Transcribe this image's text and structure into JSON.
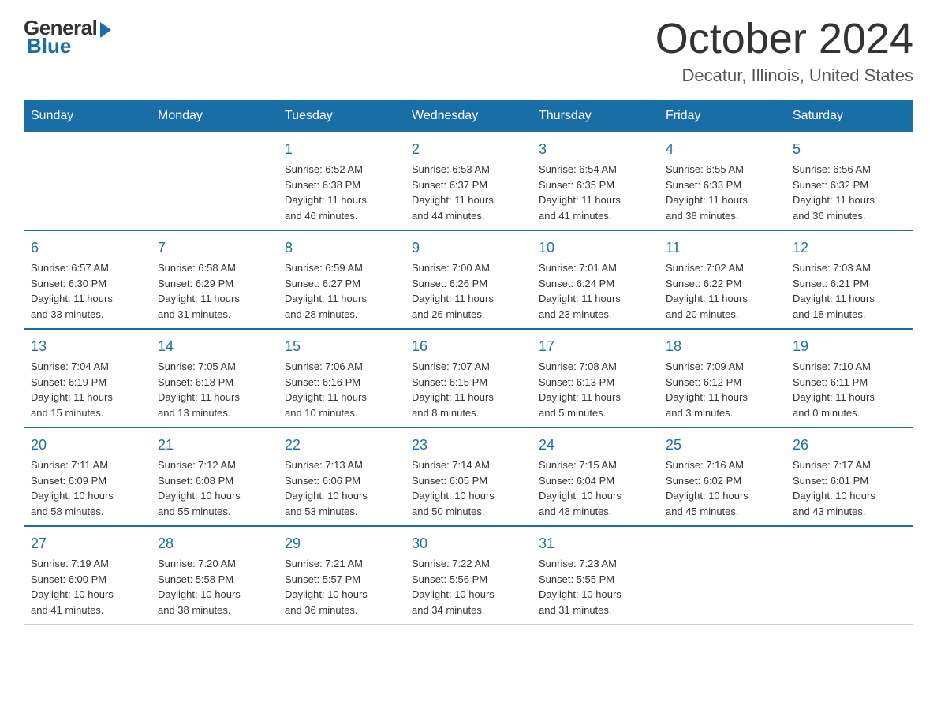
{
  "logo": {
    "general": "General",
    "blue": "Blue"
  },
  "title": "October 2024",
  "subtitle": "Decatur, Illinois, United States",
  "weekdays": [
    "Sunday",
    "Monday",
    "Tuesday",
    "Wednesday",
    "Thursday",
    "Friday",
    "Saturday"
  ],
  "weeks": [
    [
      {
        "day": "",
        "info": ""
      },
      {
        "day": "",
        "info": ""
      },
      {
        "day": "1",
        "info": "Sunrise: 6:52 AM\nSunset: 6:38 PM\nDaylight: 11 hours\nand 46 minutes."
      },
      {
        "day": "2",
        "info": "Sunrise: 6:53 AM\nSunset: 6:37 PM\nDaylight: 11 hours\nand 44 minutes."
      },
      {
        "day": "3",
        "info": "Sunrise: 6:54 AM\nSunset: 6:35 PM\nDaylight: 11 hours\nand 41 minutes."
      },
      {
        "day": "4",
        "info": "Sunrise: 6:55 AM\nSunset: 6:33 PM\nDaylight: 11 hours\nand 38 minutes."
      },
      {
        "day": "5",
        "info": "Sunrise: 6:56 AM\nSunset: 6:32 PM\nDaylight: 11 hours\nand 36 minutes."
      }
    ],
    [
      {
        "day": "6",
        "info": "Sunrise: 6:57 AM\nSunset: 6:30 PM\nDaylight: 11 hours\nand 33 minutes."
      },
      {
        "day": "7",
        "info": "Sunrise: 6:58 AM\nSunset: 6:29 PM\nDaylight: 11 hours\nand 31 minutes."
      },
      {
        "day": "8",
        "info": "Sunrise: 6:59 AM\nSunset: 6:27 PM\nDaylight: 11 hours\nand 28 minutes."
      },
      {
        "day": "9",
        "info": "Sunrise: 7:00 AM\nSunset: 6:26 PM\nDaylight: 11 hours\nand 26 minutes."
      },
      {
        "day": "10",
        "info": "Sunrise: 7:01 AM\nSunset: 6:24 PM\nDaylight: 11 hours\nand 23 minutes."
      },
      {
        "day": "11",
        "info": "Sunrise: 7:02 AM\nSunset: 6:22 PM\nDaylight: 11 hours\nand 20 minutes."
      },
      {
        "day": "12",
        "info": "Sunrise: 7:03 AM\nSunset: 6:21 PM\nDaylight: 11 hours\nand 18 minutes."
      }
    ],
    [
      {
        "day": "13",
        "info": "Sunrise: 7:04 AM\nSunset: 6:19 PM\nDaylight: 11 hours\nand 15 minutes."
      },
      {
        "day": "14",
        "info": "Sunrise: 7:05 AM\nSunset: 6:18 PM\nDaylight: 11 hours\nand 13 minutes."
      },
      {
        "day": "15",
        "info": "Sunrise: 7:06 AM\nSunset: 6:16 PM\nDaylight: 11 hours\nand 10 minutes."
      },
      {
        "day": "16",
        "info": "Sunrise: 7:07 AM\nSunset: 6:15 PM\nDaylight: 11 hours\nand 8 minutes."
      },
      {
        "day": "17",
        "info": "Sunrise: 7:08 AM\nSunset: 6:13 PM\nDaylight: 11 hours\nand 5 minutes."
      },
      {
        "day": "18",
        "info": "Sunrise: 7:09 AM\nSunset: 6:12 PM\nDaylight: 11 hours\nand 3 minutes."
      },
      {
        "day": "19",
        "info": "Sunrise: 7:10 AM\nSunset: 6:11 PM\nDaylight: 11 hours\nand 0 minutes."
      }
    ],
    [
      {
        "day": "20",
        "info": "Sunrise: 7:11 AM\nSunset: 6:09 PM\nDaylight: 10 hours\nand 58 minutes."
      },
      {
        "day": "21",
        "info": "Sunrise: 7:12 AM\nSunset: 6:08 PM\nDaylight: 10 hours\nand 55 minutes."
      },
      {
        "day": "22",
        "info": "Sunrise: 7:13 AM\nSunset: 6:06 PM\nDaylight: 10 hours\nand 53 minutes."
      },
      {
        "day": "23",
        "info": "Sunrise: 7:14 AM\nSunset: 6:05 PM\nDaylight: 10 hours\nand 50 minutes."
      },
      {
        "day": "24",
        "info": "Sunrise: 7:15 AM\nSunset: 6:04 PM\nDaylight: 10 hours\nand 48 minutes."
      },
      {
        "day": "25",
        "info": "Sunrise: 7:16 AM\nSunset: 6:02 PM\nDaylight: 10 hours\nand 45 minutes."
      },
      {
        "day": "26",
        "info": "Sunrise: 7:17 AM\nSunset: 6:01 PM\nDaylight: 10 hours\nand 43 minutes."
      }
    ],
    [
      {
        "day": "27",
        "info": "Sunrise: 7:19 AM\nSunset: 6:00 PM\nDaylight: 10 hours\nand 41 minutes."
      },
      {
        "day": "28",
        "info": "Sunrise: 7:20 AM\nSunset: 5:58 PM\nDaylight: 10 hours\nand 38 minutes."
      },
      {
        "day": "29",
        "info": "Sunrise: 7:21 AM\nSunset: 5:57 PM\nDaylight: 10 hours\nand 36 minutes."
      },
      {
        "day": "30",
        "info": "Sunrise: 7:22 AM\nSunset: 5:56 PM\nDaylight: 10 hours\nand 34 minutes."
      },
      {
        "day": "31",
        "info": "Sunrise: 7:23 AM\nSunset: 5:55 PM\nDaylight: 10 hours\nand 31 minutes."
      },
      {
        "day": "",
        "info": ""
      },
      {
        "day": "",
        "info": ""
      }
    ]
  ]
}
